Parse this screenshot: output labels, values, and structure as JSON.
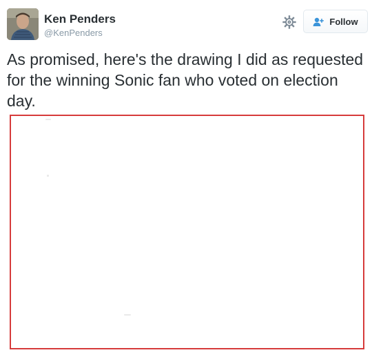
{
  "user": {
    "display_name": "Ken Penders",
    "screen_name": "@KenPenders",
    "avatar_icon": "user-avatar"
  },
  "actions": {
    "settings_icon": "gear-icon",
    "follow_label": "Follow",
    "follow_icon": "add-user-icon"
  },
  "tweet": {
    "text": "As promised, here's the drawing I did as requested for the winning Sonic fan who voted on election day."
  },
  "media": {
    "border_color": "#d63a3a",
    "background": "#ffffff"
  },
  "colors": {
    "text": "#292f33",
    "secondary": "#8899a6",
    "follow_icon": "#3b94d9"
  }
}
